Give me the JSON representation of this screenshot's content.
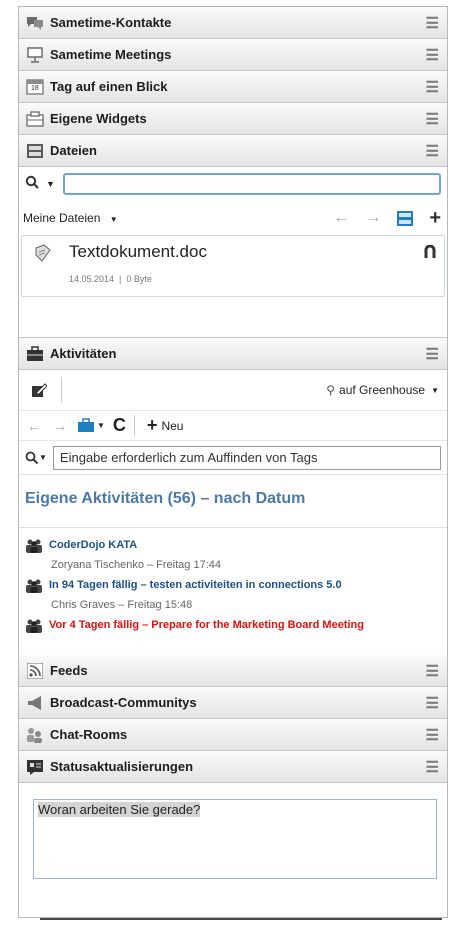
{
  "sections": {
    "sametime_contacts": {
      "title": "Sametime-Kontakte"
    },
    "sametime_meetings": {
      "title": "Sametime Meetings"
    },
    "day_at_a_glance": {
      "title": "Tag auf einen Blick",
      "calendar_day": "18"
    },
    "widgets": {
      "title": "Eigene Widgets"
    },
    "files": {
      "title": "Dateien",
      "search_value": "",
      "filter_label": "Meine Dateien",
      "items": [
        {
          "name": "Textdokument.doc",
          "meta": "14.05.2014  |  0 Byte"
        }
      ]
    },
    "activities": {
      "title": "Aktivitäten",
      "server_label": "auf Greenhouse",
      "new_label": "Neu",
      "tag_search_value": "Eingabe erforderlich zum Auffinden von Tags",
      "list_heading": "Eigene Aktivitäten (56) – nach Datum",
      "items": [
        {
          "title": "CoderDojo KATA",
          "meta": "Zoryana Tischenko – Freitag 17:44",
          "red": false
        },
        {
          "title": "In 94 Tagen fällig – testen activiteiten in connections 5.0",
          "meta": "Chris Graves – Freitag 15:48",
          "red": false
        },
        {
          "title": "Vor 4 Tagen fällig – Prepare for the Marketing Board Meeting",
          "meta": "",
          "red": true
        }
      ]
    },
    "feeds": {
      "title": "Feeds"
    },
    "broadcast": {
      "title": "Broadcast-Communitys"
    },
    "chat_rooms": {
      "title": "Chat-Rooms"
    },
    "status_updates": {
      "title": "Statusaktualisierungen",
      "input_text": "Woran arbeiten Sie gerade?"
    }
  },
  "colors": {
    "accent_blue": "#1f7fc0",
    "link_blue": "#1d4f8a",
    "overdue_red": "#e01010",
    "heading_blue": "#4a7aa8"
  }
}
